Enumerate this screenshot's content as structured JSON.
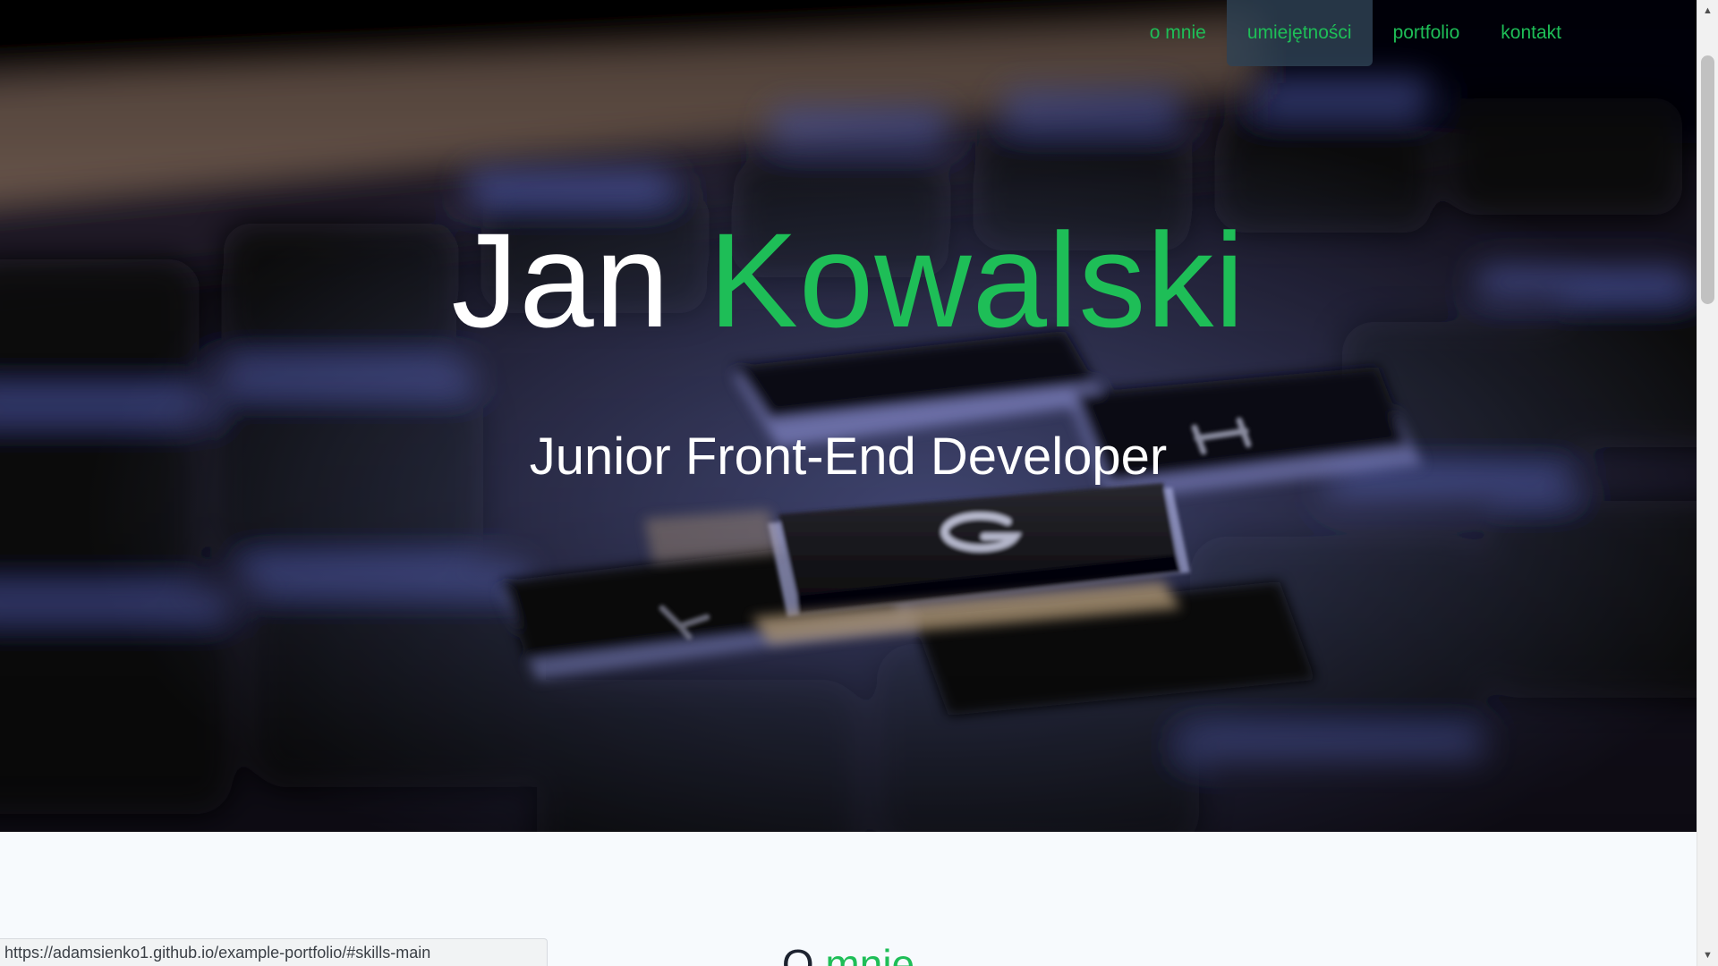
{
  "nav": {
    "items": [
      {
        "label": "o mnie",
        "active": false
      },
      {
        "label": "umiejętności",
        "active": true
      },
      {
        "label": "portfolio",
        "active": false
      },
      {
        "label": "kontakt",
        "active": false
      }
    ]
  },
  "hero": {
    "first_name": "Jan",
    "last_name": "Kowalski",
    "subtitle": "Junior Front-End Developer",
    "background_image": "laptop-keyboard-backlit-photo"
  },
  "about": {
    "title_first": "O",
    "title_rest": "mnie"
  },
  "status_bar": {
    "url": "https://adamsienko1.github.io/example-portfolio/#skills-main"
  },
  "scrollbar": {
    "up_icon": "scroll-up-arrow-icon",
    "down_icon": "scroll-down-arrow-icon"
  },
  "colors": {
    "accent": "#1ebe57",
    "nav_active_bg": "#2e4254",
    "section_bg": "#f7fafd",
    "heading_dark": "#1d2330"
  }
}
